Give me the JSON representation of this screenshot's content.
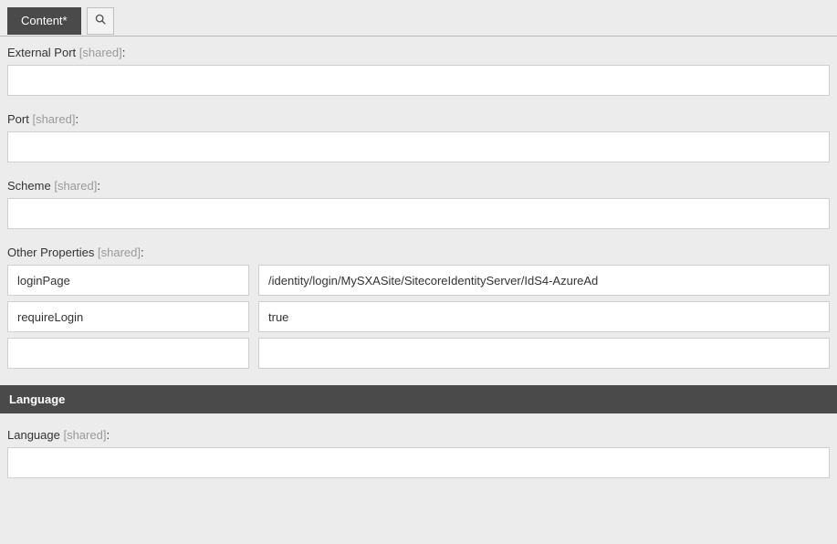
{
  "tabs": {
    "content_label": "Content*"
  },
  "shared_suffix": "[shared]",
  "fields": {
    "external_port": {
      "label": "External Port",
      "value": ""
    },
    "port": {
      "label": "Port",
      "value": ""
    },
    "scheme": {
      "label": "Scheme",
      "value": ""
    },
    "other_properties": {
      "label": "Other Properties",
      "rows": [
        {
          "key": "loginPage",
          "value": "/identity/login/MySXASite/SitecoreIdentityServer/IdS4-AzureAd"
        },
        {
          "key": "requireLogin",
          "value": "true"
        },
        {
          "key": "",
          "value": ""
        }
      ]
    }
  },
  "sections": {
    "language": {
      "header": "Language",
      "field_label": "Language",
      "value": ""
    }
  }
}
